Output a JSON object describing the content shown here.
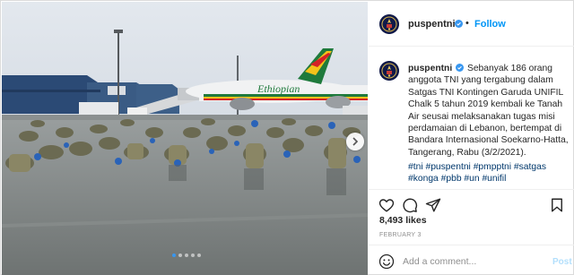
{
  "account": {
    "username": "puspentni",
    "verified": true
  },
  "header": {
    "separator": "•",
    "follow_label": "Follow"
  },
  "post": {
    "caption": "Sebanyak 186 orang anggota TNI yang tergabung dalam Satgas TNI Kontingen Garuda UNIFIL Chalk 5 tahun 2019  kembali ke Tanah Air seusai melaksanakan tugas misi perdamaian di Lebanon, bertempat di Bandara Internasional Soekarno-Hatta, Tangerang, Rabu (3/2/2021).",
    "hashtags": "#tni #puspentni #pmpptni #satgas #konga #pbb #un #unifil",
    "likes": "8,493 likes",
    "date": "FEBRUARY 3"
  },
  "photo": {
    "airplane_livery_text": "Ethiopian",
    "carousel_dots": 5,
    "active_dot": 0
  },
  "icons": {
    "like": "heart-icon",
    "comment": "comment-bubble-icon",
    "share": "paper-plane-icon",
    "save": "bookmark-icon",
    "emoji": "smiley-icon",
    "next": "chevron-right-icon",
    "verified": "verified-badge-icon"
  },
  "comment_box": {
    "placeholder": "Add a comment...",
    "post_label": "Post"
  },
  "colors": {
    "link": "#0095f6",
    "hashtag": "#00376b",
    "muted": "#8e8e8e",
    "post_disabled": "#b2dffc",
    "carousel_active": "#3897f0"
  }
}
